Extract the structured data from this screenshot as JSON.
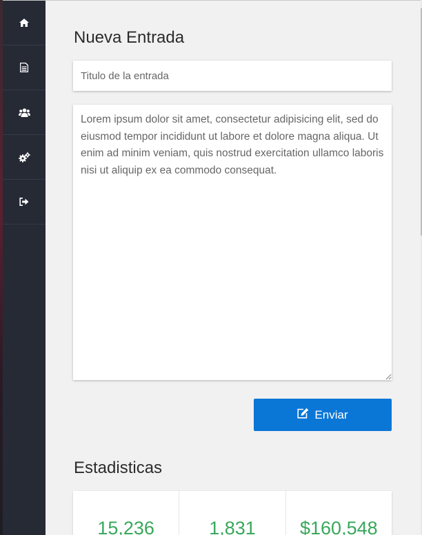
{
  "sidebar": {
    "items": [
      {
        "icon": "home-icon"
      },
      {
        "icon": "document-icon"
      },
      {
        "icon": "users-icon"
      },
      {
        "icon": "settings-gears-icon"
      },
      {
        "icon": "sign-out-icon"
      }
    ]
  },
  "editor": {
    "heading": "Nueva Entrada",
    "title_placeholder": "Titulo de la entrada",
    "body_text": "Lorem ipsum dolor sit amet, consectetur adipisicing elit, sed do eiusmod tempor incididunt ut labore et dolore magna aliqua. Ut enim ad minim veniam, quis nostrud exercitation ullamco laboris nisi ut aliquip ex ea commodo consequat.",
    "submit_label": "Enviar"
  },
  "stats": {
    "heading": "Estadisticas",
    "values": [
      "15,236",
      "1,831",
      "$160,548"
    ]
  },
  "colors": {
    "sidebar_bg": "#262a35",
    "accent_blue": "#0a76d6",
    "stat_green": "#38a85b",
    "page_bg": "#f1f1f1"
  }
}
